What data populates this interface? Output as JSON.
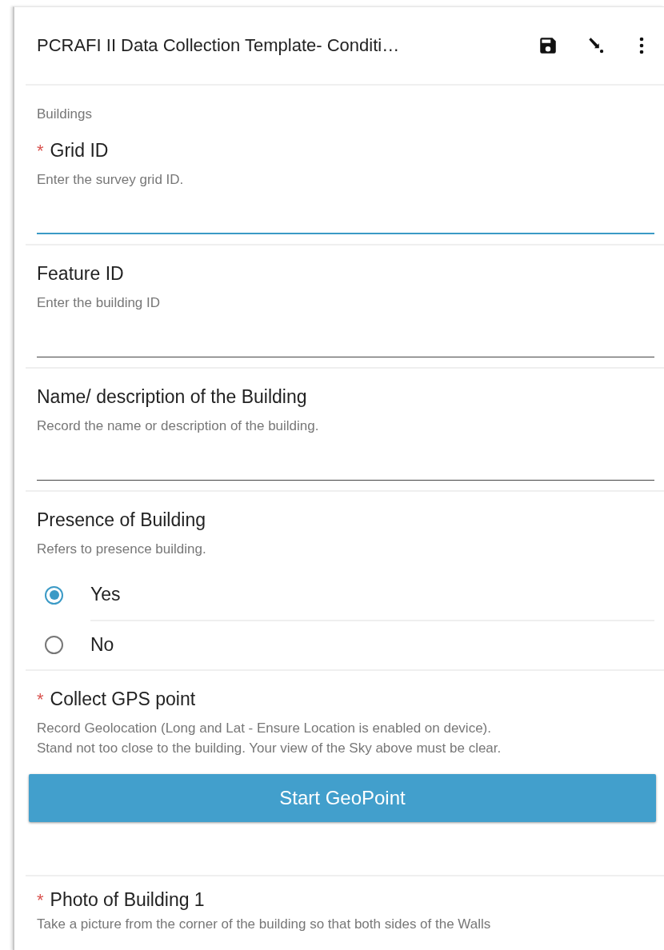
{
  "header": {
    "title": "PCRAFI II Data Collection Template- Conditi…"
  },
  "group": "Buildings",
  "questions": [
    {
      "kind": "text",
      "required_mark": "*",
      "label": "Grid ID",
      "hint": "Enter the survey grid ID.",
      "focused": true
    },
    {
      "kind": "text",
      "label": "Feature ID",
      "hint": "Enter the building ID",
      "focused": false
    },
    {
      "kind": "text",
      "label": "Name/ description of the Building",
      "hint": "Record the name or description of the building.",
      "focused": false
    },
    {
      "kind": "select_one",
      "label": "Presence of Building",
      "hint": "Refers to presence building.",
      "options": [
        {
          "label": "Yes",
          "selected": true
        },
        {
          "label": "No",
          "selected": false
        }
      ]
    },
    {
      "kind": "geopoint",
      "required_mark": "*",
      "label": "Collect GPS point",
      "hint": "Record Geolocation (Long and Lat - Ensure Location is enabled on device).\nStand not too close to the building. Your view of the Sky above must be clear.",
      "button": "Start GeoPoint"
    },
    {
      "kind": "image",
      "required_mark": "*",
      "label": "Photo of Building 1",
      "hint": "Take a picture from the corner of the building so that both sides of the Walls"
    }
  ]
}
